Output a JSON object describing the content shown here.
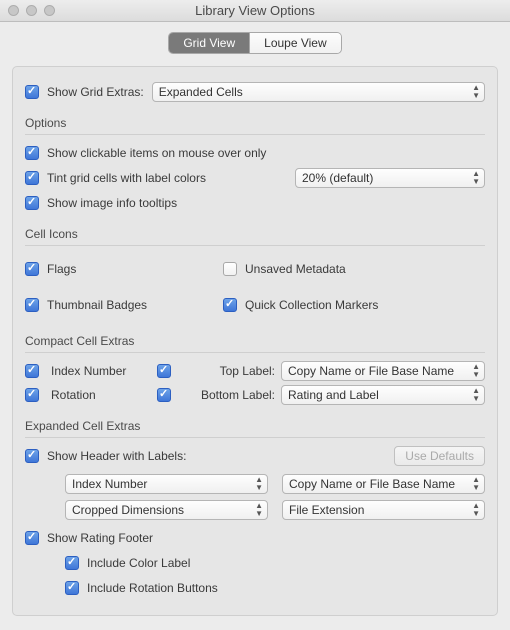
{
  "window": {
    "title": "Library View Options"
  },
  "tabs": {
    "grid": "Grid View",
    "loupe": "Loupe View"
  },
  "topRow": {
    "show_extras_label": "Show Grid Extras:",
    "extras_select": "Expanded Cells"
  },
  "options": {
    "title": "Options",
    "clickable": "Show clickable items on mouse over only",
    "tint": "Tint grid cells with label colors",
    "tint_value": "20% (default)",
    "tooltips": "Show image info tooltips"
  },
  "cellIcons": {
    "title": "Cell Icons",
    "flags": "Flags",
    "unsaved": "Unsaved Metadata",
    "badges": "Thumbnail Badges",
    "quick": "Quick Collection Markers"
  },
  "compact": {
    "title": "Compact Cell Extras",
    "index": "Index Number",
    "rotation": "Rotation",
    "top_label": "Top Label:",
    "bottom_label": "Bottom Label:",
    "top_value": "Copy Name or File Base Name",
    "bottom_value": "Rating and Label"
  },
  "expanded": {
    "title": "Expanded Cell Extras",
    "header": "Show Header with Labels:",
    "defaults_btn": "Use Defaults",
    "sel1": "Index Number",
    "sel2": "Copy Name or File Base Name",
    "sel3": "Cropped Dimensions",
    "sel4": "File Extension",
    "footer": "Show Rating Footer",
    "color": "Include Color Label",
    "rot": "Include Rotation Buttons"
  }
}
